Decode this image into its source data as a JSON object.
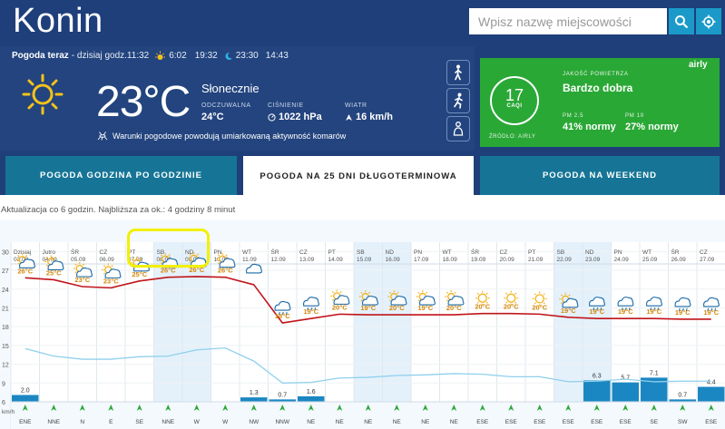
{
  "header": {
    "city": "Konin",
    "search_placeholder": "Wpisz nazwę miejscowości"
  },
  "current": {
    "title": "Pogoda teraz",
    "date_text": "- dzisiaj godz.11:32",
    "sunrise": "6:02",
    "sunset": "19:32",
    "moonrise": "23:30",
    "moonset": "14:43",
    "temperature": "23°C",
    "condition": "Słonecznie",
    "feels_label": "ODCZUWALNA",
    "feels_value": "24°C",
    "pressure_label": "CIŚNIENIE",
    "pressure_value": "1022 hPa",
    "wind_label": "WIATR",
    "wind_value": "16 km/h",
    "mosquito_text": "Warunki pogodowe powodują umiarkowaną aktywność komarów"
  },
  "air_quality": {
    "label": "JAKOŚĆ POWIETRZA",
    "value": "Bardzo dobra",
    "caqi_value": "17",
    "caqi_unit": "CAQI",
    "source": "ŹRÓDŁO: AIRLY",
    "pm25_label": "PM 2.5",
    "pm25_value": "41% normy",
    "pm10_label": "PM 10",
    "pm10_value": "27% normy",
    "brand": "airly",
    "color": "#2aa836"
  },
  "tabs": [
    {
      "label": "POGODA GODZINA PO GODZINIE",
      "active": false
    },
    {
      "label": "POGODA NA 25 DNI DŁUGOTERMINOWA",
      "active": true
    },
    {
      "label": "POGODA NA WEEKEND",
      "active": false
    }
  ],
  "update_text": "Aktualizacja co 6 godzin. Najbliższa za ok.: 4 godziny 8 minut",
  "chart_data": {
    "type": "line",
    "days": [
      {
        "name": "Dzisiaj",
        "date": "03.09",
        "temp": "26°C",
        "icon": "sun-cloud",
        "weekend": false
      },
      {
        "name": "Jutro",
        "date": "04.09",
        "temp": "25°C",
        "icon": "sun-cloud",
        "weekend": false
      },
      {
        "name": "ŚR",
        "date": "05.09",
        "temp": "23°C",
        "icon": "sun-cloud",
        "weekend": false
      },
      {
        "name": "CZ",
        "date": "06.09",
        "temp": "23°C",
        "icon": "sun-cloud",
        "weekend": false
      },
      {
        "name": "PT",
        "date": "07.09",
        "temp": "25°C",
        "icon": "sun-cloud",
        "weekend": false
      },
      {
        "name": "SB",
        "date": "08.09",
        "temp": "26°C",
        "icon": "sun-cloud",
        "weekend": true
      },
      {
        "name": "ND",
        "date": "09.09",
        "temp": "26°C",
        "icon": "sun-cloud",
        "weekend": true
      },
      {
        "name": "PN",
        "date": "10.09",
        "temp": "26°C",
        "icon": "sun-cloud",
        "weekend": false
      },
      {
        "name": "WT",
        "date": "11.09",
        "temp": "",
        "icon": "cloud",
        "weekend": false
      },
      {
        "name": "ŚR",
        "date": "12.09",
        "temp": "18°C",
        "icon": "rain",
        "weekend": false
      },
      {
        "name": "CZ",
        "date": "13.09",
        "temp": "19°C",
        "icon": "rain",
        "weekend": false
      },
      {
        "name": "PT",
        "date": "14.09",
        "temp": "20°C",
        "icon": "sun-cloud",
        "weekend": false
      },
      {
        "name": "SB",
        "date": "15.09",
        "temp": "19°C",
        "icon": "sun-cloud",
        "weekend": true
      },
      {
        "name": "ND",
        "date": "16.09",
        "temp": "20°C",
        "icon": "sun-cloud",
        "weekend": true
      },
      {
        "name": "PN",
        "date": "17.09",
        "temp": "19°C",
        "icon": "sun-cloud",
        "weekend": false
      },
      {
        "name": "WT",
        "date": "18.09",
        "temp": "20°C",
        "icon": "sun-cloud",
        "weekend": false
      },
      {
        "name": "ŚR",
        "date": "19.09",
        "temp": "20°C",
        "icon": "sun",
        "weekend": false
      },
      {
        "name": "CZ",
        "date": "20.09",
        "temp": "20°C",
        "icon": "sun",
        "weekend": false
      },
      {
        "name": "PT",
        "date": "21.09",
        "temp": "20°C",
        "icon": "sun",
        "weekend": false
      },
      {
        "name": "SB",
        "date": "22.09",
        "temp": "19°C",
        "icon": "sun-cloud",
        "weekend": true
      },
      {
        "name": "ND",
        "date": "23.09",
        "temp": "19°C",
        "icon": "rain",
        "weekend": true
      },
      {
        "name": "PN",
        "date": "24.09",
        "temp": "19°C",
        "icon": "rain",
        "weekend": false
      },
      {
        "name": "WT",
        "date": "25.09",
        "temp": "19°C",
        "icon": "rain",
        "weekend": false
      },
      {
        "name": "ŚR",
        "date": "26.09",
        "temp": "19°C",
        "icon": "rain",
        "weekend": false
      },
      {
        "name": "CZ",
        "date": "27.09",
        "temp": "19°C",
        "icon": "rain",
        "weekend": false
      }
    ],
    "y_ticks": [
      30,
      27,
      24,
      21,
      18,
      15,
      12,
      9,
      6
    ],
    "y_range": [
      6,
      31.5
    ],
    "temp_max": [
      25.8,
      25.5,
      24.4,
      24.2,
      25.3,
      25.9,
      26.0,
      25.9,
      24.7,
      18.6,
      19.3,
      20.0,
      19.9,
      19.9,
      19.9,
      19.9,
      20.1,
      20.1,
      20.0,
      19.5,
      19.3,
      19.3,
      19.3,
      19.2,
      19.2
    ],
    "temp_min": [
      14.5,
      13.3,
      12.8,
      12.8,
      13.2,
      13.3,
      14.3,
      14.6,
      12.5,
      9.0,
      9.1,
      9.8,
      9.9,
      10.2,
      10.3,
      10.5,
      10.4,
      10.0,
      10.0,
      9.2,
      9.3,
      9.6,
      9.2,
      9.3,
      9.3
    ],
    "precip": [
      2.0,
      0,
      0,
      0,
      0,
      0,
      0,
      0,
      1.3,
      0.7,
      1.6,
      0,
      0,
      0,
      0,
      0,
      0,
      0,
      0,
      0,
      6.3,
      5.7,
      7.1,
      0.7,
      4.4
    ],
    "precip_labels": [
      "2.0",
      "",
      "",
      "",
      "",
      "",
      "",
      "",
      "1.3",
      "0.7",
      "1.6",
      "",
      "",
      "",
      "",
      "",
      "",
      "",
      "",
      "",
      "6.3",
      "5.7",
      "7.1",
      "0.7",
      "4.4"
    ],
    "precip_max": 8,
    "wind_dirs": [
      "ENE",
      "NNE",
      "N",
      "E",
      "SE",
      "NNE",
      "W",
      "W",
      "NW",
      "NNW",
      "NE",
      "NE",
      "NE",
      "NE",
      "NE",
      "NE",
      "ESE",
      "ESE",
      "ESE",
      "ESE",
      "ESE",
      "ESE",
      "SE",
      "SW",
      "ESE"
    ],
    "wind_unit": "km/h",
    "colors": {
      "temp_max": "#c0141a",
      "temp_min": "#8fd0ec",
      "precip": "#1b87c2",
      "weekend": "#e4f1fb"
    }
  }
}
